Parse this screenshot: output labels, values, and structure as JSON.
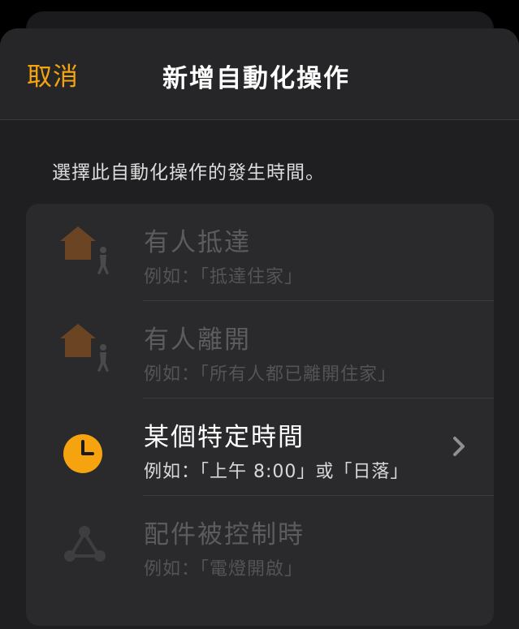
{
  "nav": {
    "cancel_label": "取消",
    "title": "新增自動化操作"
  },
  "prompt": "選擇此自動化操作的發生時間。",
  "colors": {
    "accent": "#f5a40f",
    "house_icon": "#6b4423",
    "disabled_text": "#5c5c5e"
  },
  "options": [
    {
      "label": "有人抵達",
      "example": "例如：「抵達住家」",
      "icon": "house-person-icon",
      "enabled": false
    },
    {
      "label": "有人離開",
      "example": "例如：「所有人都已離開住家」",
      "icon": "house-person-icon",
      "enabled": false
    },
    {
      "label": "某個特定時間",
      "example": "例如：「上午 8:00」或「日落」",
      "icon": "clock-icon",
      "enabled": true
    },
    {
      "label": "配件被控制時",
      "example": "例如：「電燈開啟」",
      "icon": "accessory-triangle-icon",
      "enabled": false
    }
  ]
}
